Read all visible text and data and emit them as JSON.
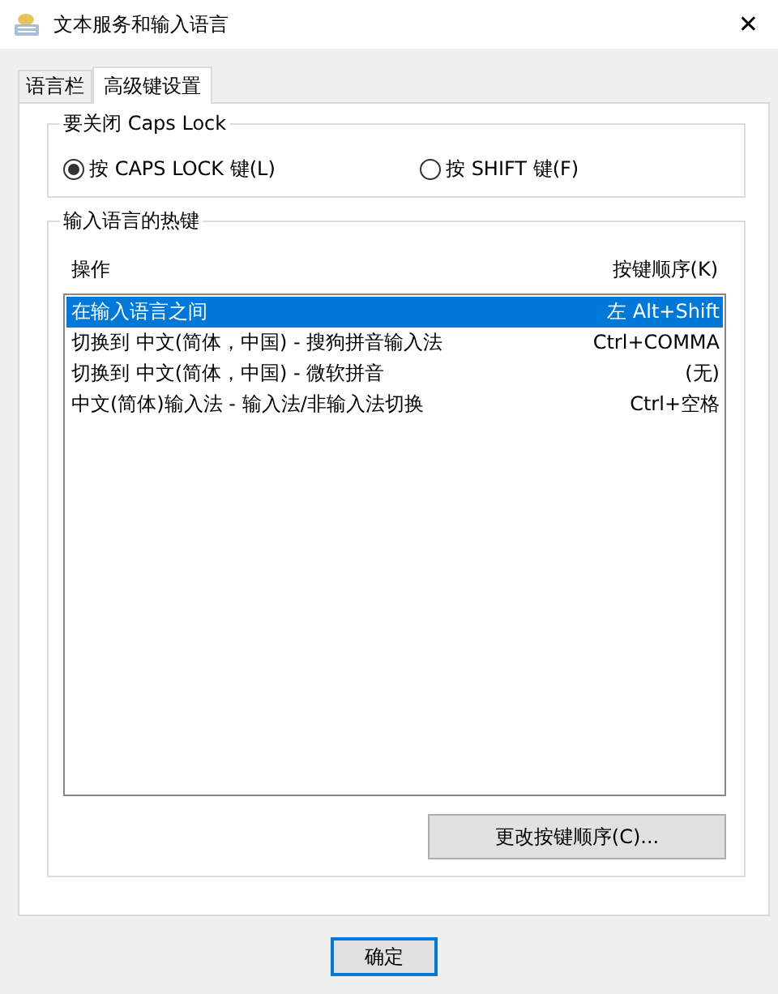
{
  "window": {
    "title": "文本服务和输入语言",
    "close": "✕"
  },
  "tabs": [
    {
      "label": "语言栏",
      "selected": false
    },
    {
      "label": "高级键设置",
      "selected": true
    }
  ],
  "caps_lock_group": {
    "title": "要关闭 Caps Lock",
    "options": [
      {
        "label": "按 CAPS LOCK 键(L)",
        "selected": true
      },
      {
        "label": "按 SHIFT 键(F)",
        "selected": false
      }
    ]
  },
  "hotkeys_group": {
    "title": "输入语言的热键",
    "columns": [
      "操作",
      "按键顺序(K)"
    ],
    "rows": [
      {
        "action": "在输入语言之间",
        "keys": "左 Alt+Shift",
        "selected": true
      },
      {
        "action": "切换到 中文(简体，中国) - 搜狗拼音输入法",
        "keys": "Ctrl+COMMA",
        "selected": false
      },
      {
        "action": "切换到 中文(简体，中国) - 微软拼音",
        "keys": "(无)",
        "selected": false
      },
      {
        "action": "中文(简体)输入法 - 输入法/非输入法切换",
        "keys": "Ctrl+空格",
        "selected": false
      }
    ],
    "change_button": "更改按键顺序(C)..."
  },
  "buttons": [
    "确定"
  ]
}
